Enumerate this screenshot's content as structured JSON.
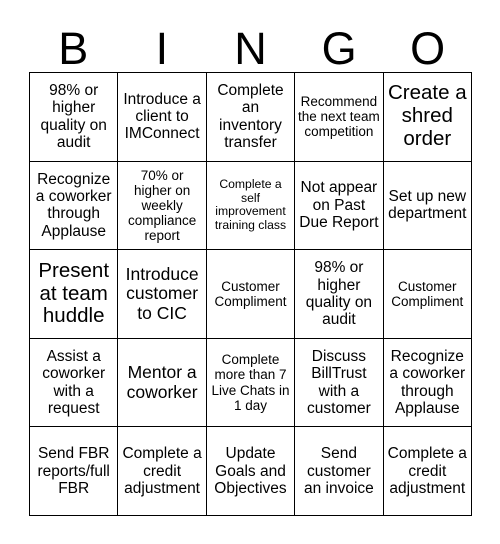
{
  "card": {
    "title": "BINGO",
    "header_letters": [
      "B",
      "I",
      "N",
      "G",
      "O"
    ],
    "columns": 5,
    "rows": 5,
    "colors": {
      "background": "#ffffff",
      "grid_line": "#000000",
      "text": "#000000"
    },
    "cells": [
      {
        "text": "98% or higher quality on audit",
        "size": "md"
      },
      {
        "text": "Introduce a client to IMConnect",
        "size": "md"
      },
      {
        "text": "Complete an inventory transfer",
        "size": "md"
      },
      {
        "text": "Recommend the next team competition",
        "size": "sm"
      },
      {
        "text": "Create a shred order",
        "size": "xl"
      },
      {
        "text": "Recognize a coworker through Applause",
        "size": "md"
      },
      {
        "text": "70% or higher on weekly compliance report",
        "size": "sm"
      },
      {
        "text": "Complete a self improvement training class",
        "size": "xs"
      },
      {
        "text": "Not appear on Past Due Report",
        "size": "md"
      },
      {
        "text": "Set up new department",
        "size": "md"
      },
      {
        "text": "Present at team huddle",
        "size": "xl"
      },
      {
        "text": "Introduce customer to CIC",
        "size": "lg"
      },
      {
        "text": "Customer Compliment",
        "size": "sm"
      },
      {
        "text": "98% or higher quality on audit",
        "size": "md"
      },
      {
        "text": "Customer Compliment",
        "size": "sm"
      },
      {
        "text": "Assist a coworker with a request",
        "size": "md"
      },
      {
        "text": "Mentor a coworker",
        "size": "lg"
      },
      {
        "text": "Complete more than 7 Live Chats in 1 day",
        "size": "sm"
      },
      {
        "text": "Discuss BillTrust with a customer",
        "size": "md"
      },
      {
        "text": "Recognize a coworker through Applause",
        "size": "md"
      },
      {
        "text": "Send FBR reports/full FBR",
        "size": "md"
      },
      {
        "text": "Complete a credit adjustment",
        "size": "md"
      },
      {
        "text": "Update Goals and Objectives",
        "size": "md"
      },
      {
        "text": "Send customer an invoice",
        "size": "md"
      },
      {
        "text": "Complete a credit adjustment",
        "size": "md"
      }
    ]
  }
}
